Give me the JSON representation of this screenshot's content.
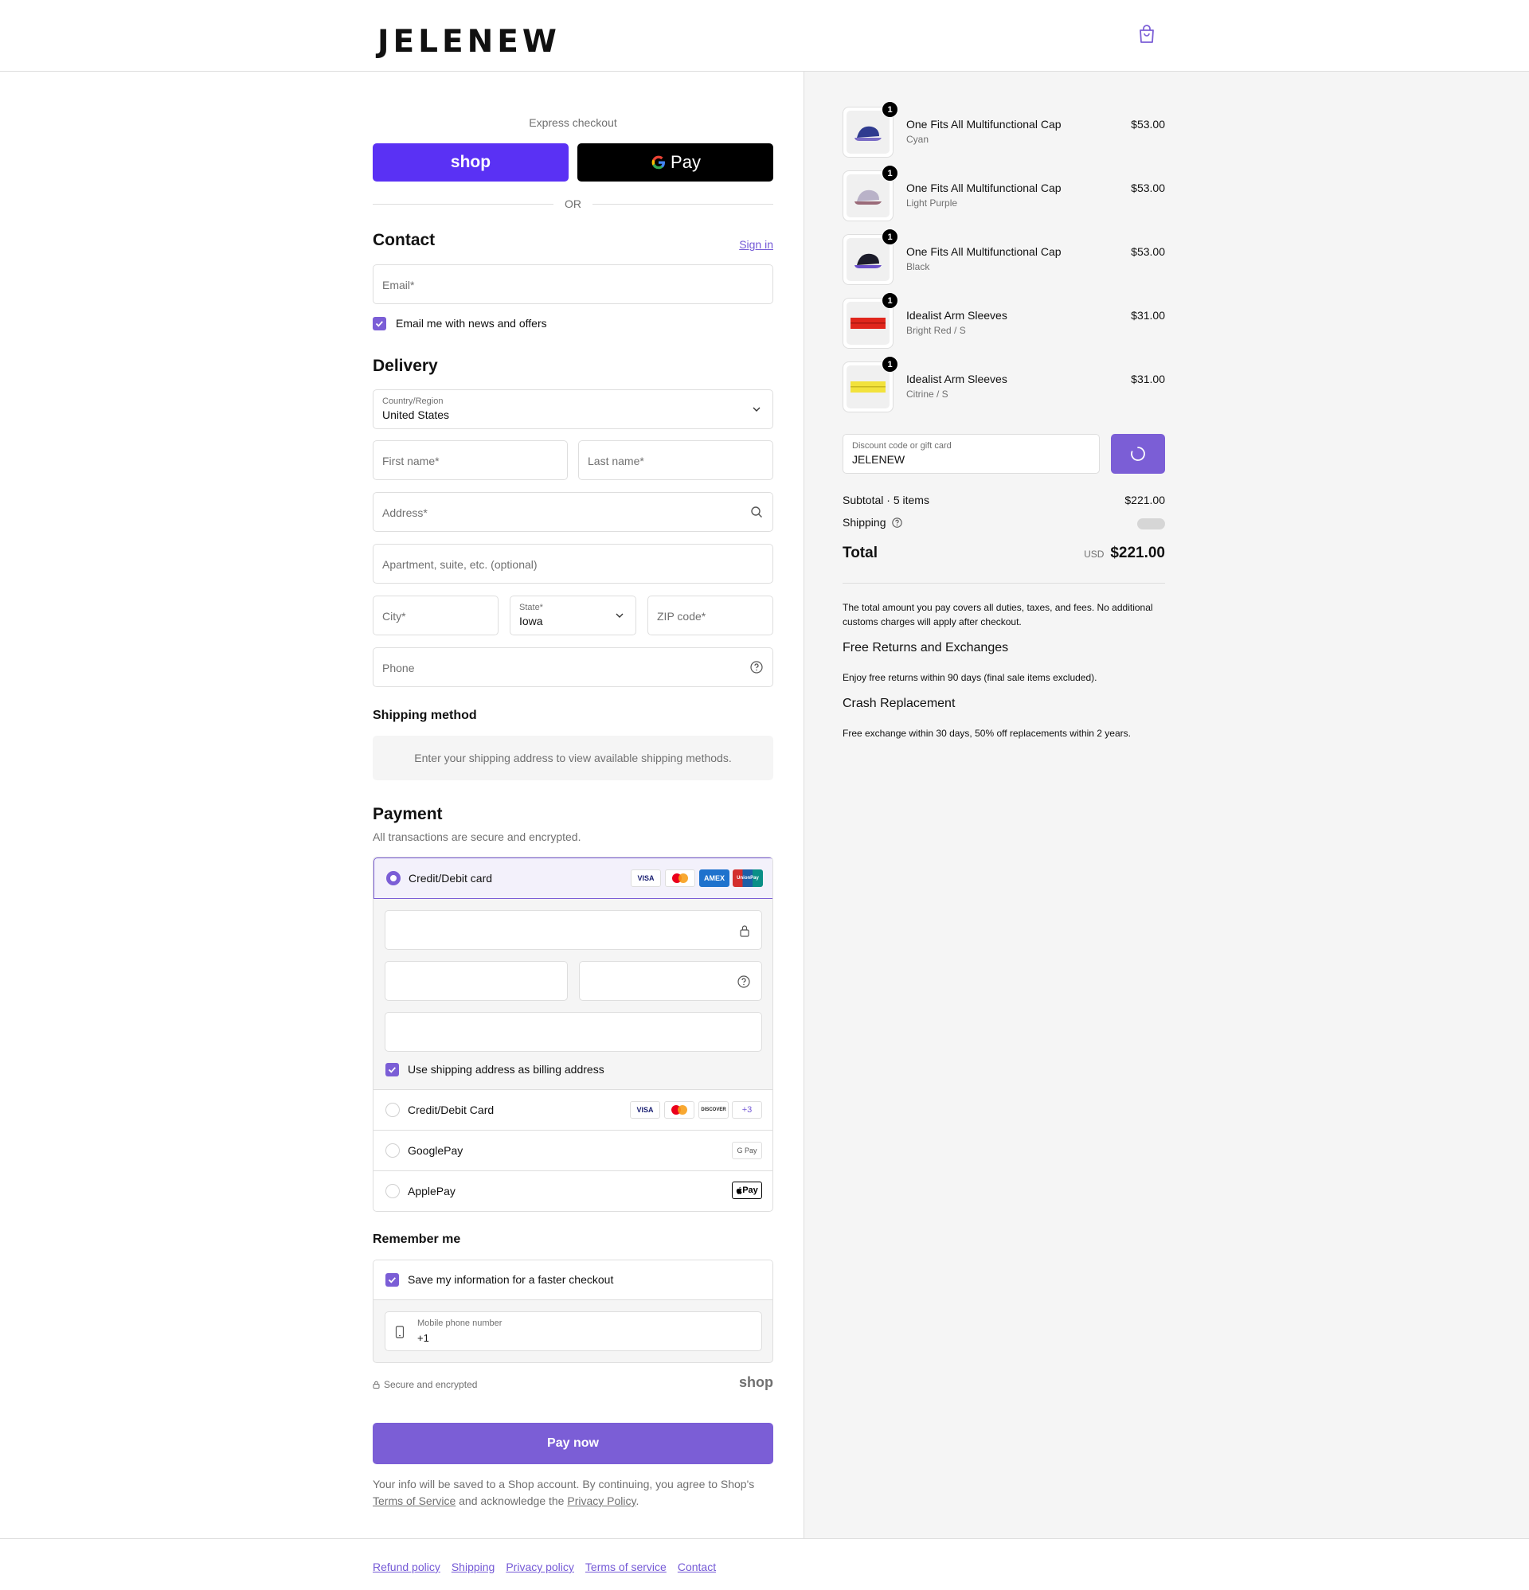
{
  "header": {
    "logo": "JELENEW",
    "cart_icon": "shopping-bag-icon"
  },
  "express": {
    "label": "Express checkout",
    "shop_pay": "shop",
    "google_pay": "Pay",
    "or": "OR"
  },
  "contact": {
    "title": "Contact",
    "sign_in": "Sign in",
    "email_placeholder": "Email*",
    "news_checkbox": "Email me with news and offers"
  },
  "delivery": {
    "title": "Delivery",
    "country_label": "Country/Region",
    "country_value": "United States",
    "first_name": "First name*",
    "last_name": "Last name*",
    "address": "Address*",
    "apartment": "Apartment, suite, etc. (optional)",
    "city": "City*",
    "state_label": "State*",
    "state_value": "Iowa",
    "zip": "ZIP code*",
    "phone": "Phone"
  },
  "shipping_method": {
    "title": "Shipping method",
    "placeholder": "Enter your shipping address to view available shipping methods."
  },
  "payment": {
    "title": "Payment",
    "subtitle": "All transactions are secure and encrypted.",
    "options": [
      {
        "label": "Credit/Debit card",
        "selected": true,
        "logos": [
          "VISA",
          "mastercard",
          "AMEX",
          "UnionPay"
        ]
      },
      {
        "label": "Credit/Debit Card",
        "selected": false,
        "logos": [
          "VISA",
          "mastercard",
          "DISCOVER",
          "+3"
        ]
      },
      {
        "label": "GooglePay",
        "selected": false,
        "logos": [
          "G Pay"
        ]
      },
      {
        "label": "ApplePay",
        "selected": false,
        "logos": [
          "Pay"
        ]
      }
    ],
    "billing_checkbox": "Use shipping address as billing address"
  },
  "remember": {
    "title": "Remember me",
    "save_checkbox": "Save my information for a faster checkout",
    "mobile_label": "Mobile phone number",
    "mobile_value": "+1",
    "secure_note": "Secure and encrypted",
    "shop_brand": "shop"
  },
  "pay_now": "Pay now",
  "legal": {
    "text_1": "Your info will be saved to a Shop account. By continuing, you agree to Shop's",
    "terms": "Terms of Service",
    "text_2": "and acknowledge the",
    "privacy": "Privacy Policy",
    "text_3": "."
  },
  "footer": {
    "links": [
      "Refund policy",
      "Shipping",
      "Privacy policy",
      "Terms of service",
      "Contact"
    ]
  },
  "summary": {
    "items": [
      {
        "qty": "1",
        "name": "One Fits All Multifunctional Cap",
        "variant": "Cyan",
        "price": "$53.00",
        "color": "#2f3b8f"
      },
      {
        "qty": "1",
        "name": "One Fits All Multifunctional Cap",
        "variant": "Light Purple",
        "price": "$53.00",
        "color": "#b9b2c8"
      },
      {
        "qty": "1",
        "name": "One Fits All Multifunctional Cap",
        "variant": "Black",
        "price": "$53.00",
        "color": "#1c1c2a"
      },
      {
        "qty": "1",
        "name": "Idealist Arm Sleeves",
        "variant": "Bright Red / S",
        "price": "$31.00",
        "color": "#e0261c"
      },
      {
        "qty": "1",
        "name": "Idealist Arm Sleeves",
        "variant": "Citrine / S",
        "price": "$31.00",
        "color": "#f2e23c"
      }
    ],
    "discount_label": "Discount code or gift card",
    "discount_value": "JELENEW",
    "subtotal_label": "Subtotal · 5 items",
    "subtotal_value": "$221.00",
    "shipping_label": "Shipping",
    "total_label": "Total",
    "currency": "USD",
    "total_value": "$221.00",
    "duties_note": "The total amount you pay covers all duties, taxes, and fees. No additional customs charges will apply after checkout.",
    "returns_title": "Free Returns and Exchanges",
    "returns_text": "Enjoy free returns within 90 days (final sale items excluded).",
    "crash_title": "Crash Replacement",
    "crash_text": "Free exchange within 30 days, 50% off replacements within 2 years."
  },
  "colors": {
    "accent": "#7b5ed6",
    "shop_pay": "#5a31f4"
  }
}
